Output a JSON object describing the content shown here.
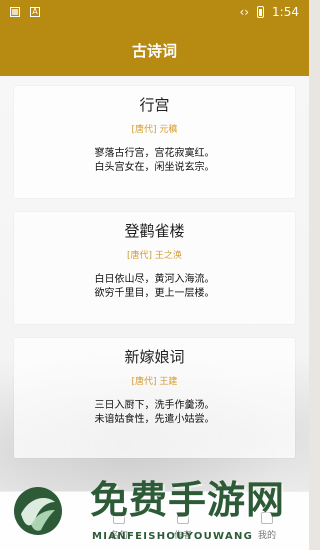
{
  "status": {
    "left_icons": [
      {
        "name": "app-icon-1",
        "glyph": "▦"
      },
      {
        "name": "app-icon-2",
        "glyph": "A"
      }
    ],
    "vibrate_glyph": "‹›",
    "battery_glyph": "",
    "time": "1:54"
  },
  "header": {
    "title": "古诗词"
  },
  "poems": [
    {
      "title": "行宫",
      "meta": "[唐代] 元稹",
      "lines": [
        "寥落古行宫，宫花寂寞红。",
        "白头宫女在，闲坐说玄宗。"
      ]
    },
    {
      "title": "登鹳雀楼",
      "meta": "[唐代] 王之涣",
      "lines": [
        "白日依山尽，黄河入海流。",
        "欲穷千里目，更上一层楼。"
      ]
    },
    {
      "title": "新嫁娘词",
      "meta": "[唐代] 王建",
      "lines": [
        "三日入厨下，洗手作羹汤。",
        "未谙姑食性，先遣小姑尝。"
      ]
    }
  ],
  "bottom_nav": [
    {
      "label": "名句"
    },
    {
      "label": "作者"
    },
    {
      "label": "我的"
    }
  ],
  "watermark": {
    "main": "免费手游网",
    "sub": "MIANFEISHOUYOUWANG"
  },
  "colors": {
    "accent": "#b78a12",
    "meta": "#d39a2c",
    "watermark": "#2d5b37"
  }
}
